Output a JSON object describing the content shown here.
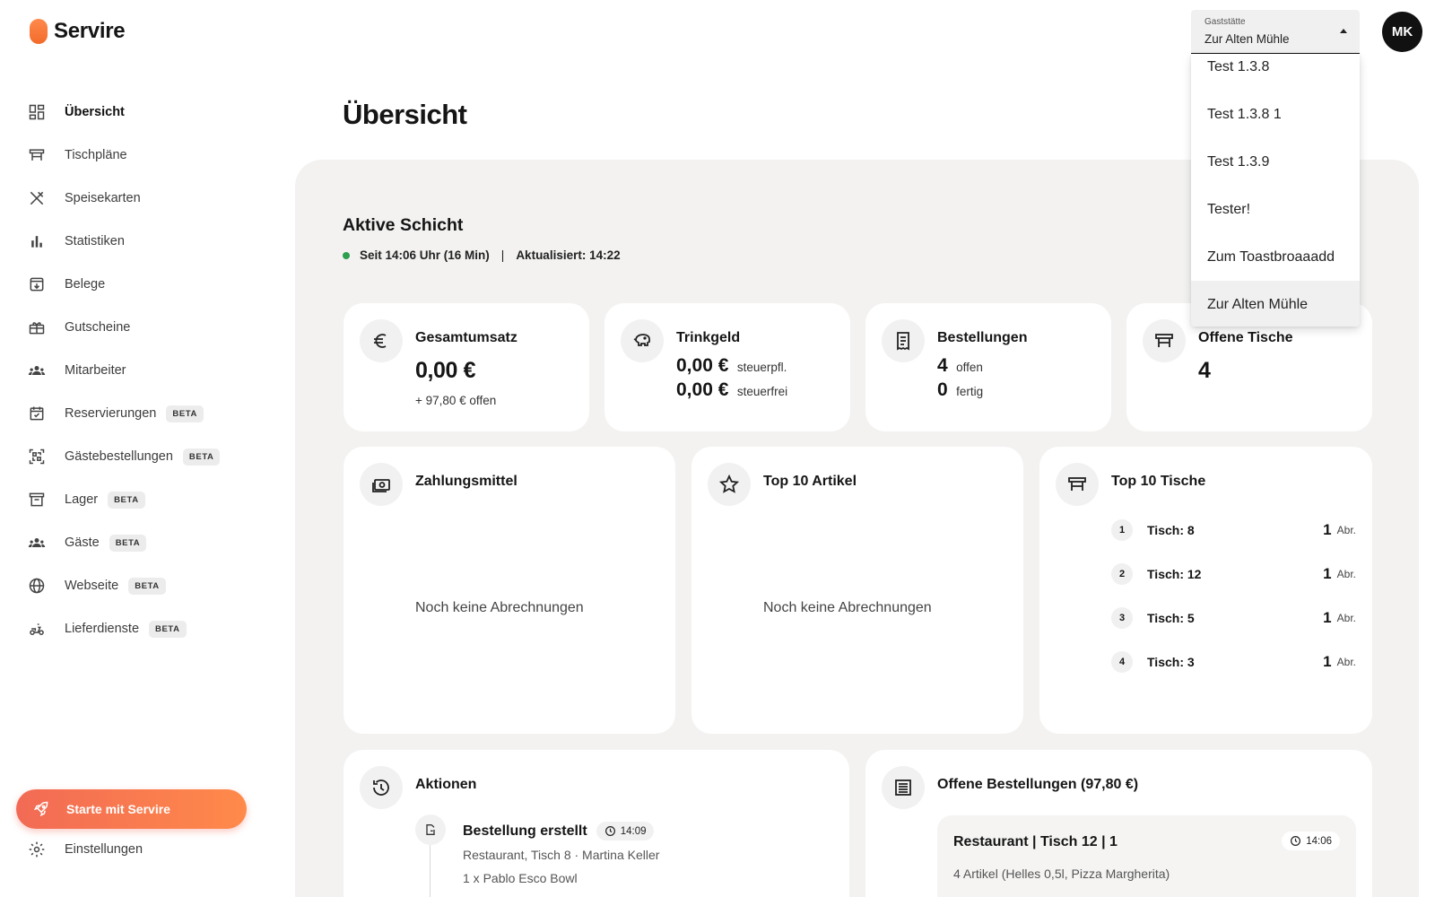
{
  "app": {
    "name": "Servire"
  },
  "sidebar": {
    "items": [
      {
        "label": "Übersicht",
        "icon": "dashboard-icon"
      },
      {
        "label": "Tischpläne",
        "icon": "table-icon"
      },
      {
        "label": "Speisekarten",
        "icon": "utensils-icon"
      },
      {
        "label": "Statistiken",
        "icon": "bar-chart-icon"
      },
      {
        "label": "Belege",
        "icon": "receipt-box-icon"
      },
      {
        "label": "Gutscheine",
        "icon": "gift-icon"
      },
      {
        "label": "Mitarbeiter",
        "icon": "people-icon"
      },
      {
        "label": "Reservierungen",
        "icon": "calendar-check-icon",
        "badge": "BETA"
      },
      {
        "label": "Gästebestellungen",
        "icon": "qr-code-icon",
        "badge": "BETA"
      },
      {
        "label": "Lager",
        "icon": "archive-icon",
        "badge": "BETA"
      },
      {
        "label": "Gäste",
        "icon": "guests-icon",
        "badge": "BETA"
      },
      {
        "label": "Webseite",
        "icon": "globe-icon",
        "badge": "BETA"
      },
      {
        "label": "Lieferdienste",
        "icon": "scooter-icon",
        "badge": "BETA"
      }
    ],
    "cta_label": "Starte mit Servire",
    "settings_label": "Einstellungen"
  },
  "header": {
    "select_label": "Gaststätte",
    "select_value": "Zur Alten Mühle",
    "avatar_initials": "MK",
    "dropdown_options": [
      "Test 1.3.8",
      "Test 1.3.8 1",
      "Test 1.3.9",
      "Tester!",
      "Zum Toastbroaaadd",
      "Zur Alten Mühle"
    ],
    "dropdown_selected": "Zur Alten Mühle"
  },
  "page": {
    "title": "Übersicht"
  },
  "shift": {
    "title": "Aktive Schicht",
    "since": "Seit 14:06 Uhr (16 Min)",
    "separator": "|",
    "updated": "Aktualisiert: 14:22"
  },
  "stats": {
    "revenue": {
      "title": "Gesamtumsatz",
      "value": "0,00 €",
      "open": "+ 97,80 € offen"
    },
    "tips": {
      "title": "Trinkgeld",
      "taxed_value": "0,00 €",
      "taxed_label": "steuerpfl.",
      "free_value": "0,00 €",
      "free_label": "steuerfrei"
    },
    "orders": {
      "title": "Bestellungen",
      "open_count": "4",
      "open_label": "offen",
      "done_count": "0",
      "done_label": "fertig"
    },
    "tables": {
      "title": "Offene Tische",
      "value": "4"
    }
  },
  "payment": {
    "title": "Zahlungsmittel",
    "empty": "Noch keine Abrechnungen"
  },
  "top_articles": {
    "title": "Top 10 Artikel",
    "empty": "Noch keine Abrechnungen"
  },
  "top_tables": {
    "title": "Top 10 Tische",
    "rows": [
      {
        "rank": "1",
        "name": "Tisch: 8",
        "count": "1",
        "unit": "Abr."
      },
      {
        "rank": "2",
        "name": "Tisch: 12",
        "count": "1",
        "unit": "Abr."
      },
      {
        "rank": "3",
        "name": "Tisch: 5",
        "count": "1",
        "unit": "Abr."
      },
      {
        "rank": "4",
        "name": "Tisch: 3",
        "count": "1",
        "unit": "Abr."
      }
    ]
  },
  "actions": {
    "title": "Aktionen",
    "items": [
      {
        "title": "Bestellung erstellt",
        "time": "14:09",
        "sub1": "Restaurant, Tisch 8 · Martina Keller",
        "sub2": "1 x Pablo Esco Bowl"
      }
    ]
  },
  "open_orders": {
    "title": "Offene Bestellungen (97,80 €)",
    "items": [
      {
        "title": "Restaurant | Tisch 12 | 1",
        "time": "14:06",
        "sub": "4 Artikel (Helles 0,5l, Pizza Margherita)"
      }
    ]
  },
  "colors": {
    "accent_start": "#f26a55",
    "accent_end": "#ff8a4a",
    "status_green": "#2e9e4f",
    "panel_bg": "#f3f2f1"
  }
}
